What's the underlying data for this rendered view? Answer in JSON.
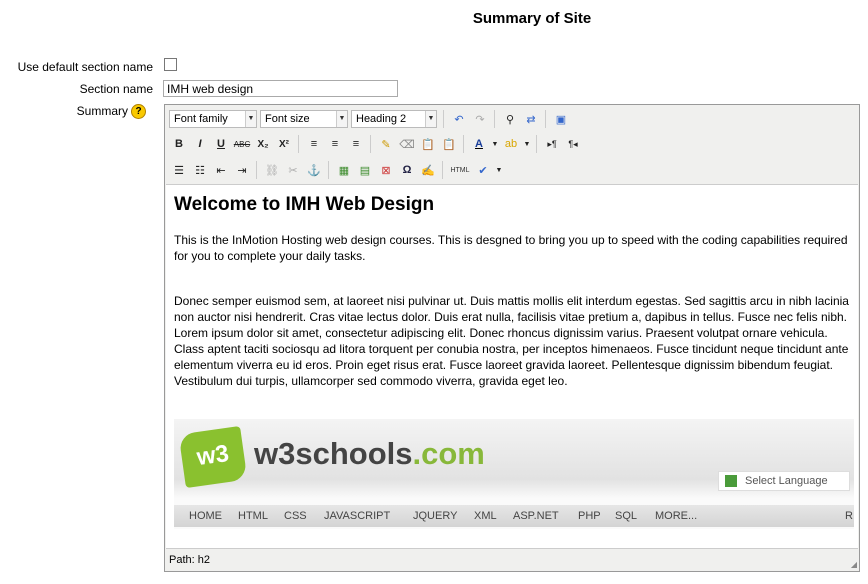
{
  "page": {
    "title": "Summary of Site"
  },
  "form": {
    "use_default_label": "Use default section name",
    "use_default_checked": false,
    "section_name_label": "Section name",
    "section_name_value": "IMH web design",
    "summary_label": "Summary",
    "help_symbol": "?"
  },
  "toolbar": {
    "font_family": "Font family",
    "font_size": "Font size",
    "format": "Heading 2",
    "row1_icons": [
      "undo-icon",
      "redo-icon",
      "find-icon",
      "replace-icon",
      "fullscreen-icon"
    ],
    "row2_labels": {
      "bold": "B",
      "italic": "I",
      "underline": "U",
      "strike": "ABC",
      "sub": "X₂",
      "sup": "X²",
      "text_color": "A",
      "ltr": "▸¶",
      "rtl": "¶◂"
    },
    "html_label": "HTML"
  },
  "content": {
    "heading": "Welcome to IMH Web Design",
    "para1": "This is the InMotion Hosting web design courses. This is desgned to bring you up to speed with the coding capabilities required for you to complete your daily tasks.",
    "para2": "Donec semper euismod sem, at laoreet nisi pulvinar ut. Duis mattis mollis elit interdum egestas. Sed sagittis arcu in nibh lacinia non auctor nisi hendrerit. Cras vitae lectus dolor. Duis erat nulla, facilisis vitae pretium a, dapibus in tellus. Fusce nec felis nibh. Lorem ipsum dolor sit amet, consectetur adipiscing elit. Donec rhoncus dignissim varius. Praesent volutpat ornare vehicula. Class aptent taciti sociosqu ad litora torquent per conubia nostra, per inceptos himenaeos. Fusce tincidunt neque tincidunt ante elementum viverra eu id eros. Proin eget risus erat. Fusce laoreet gravida laoreet. Pellentesque dignissim bibendum feugiat. Vestibulum dui turpis, ullamcorper sed commodo viverra, gravida eget leo.",
    "banner": {
      "logo_mark": "w3",
      "logo_name": "w3schools",
      "logo_tld": ".com",
      "select_language": "Select Language",
      "nav": [
        "HOME",
        "HTML",
        "CSS",
        "JAVASCRIPT",
        "JQUERY",
        "XML",
        "ASP.NET",
        "PHP",
        "SQL",
        "MORE...",
        "R"
      ]
    }
  },
  "status": {
    "path": "Path: h2"
  },
  "colors": {
    "accent_green": "#88b83a",
    "help_yellow": "#f9c900",
    "editor_bg": "#f0f0ee"
  }
}
